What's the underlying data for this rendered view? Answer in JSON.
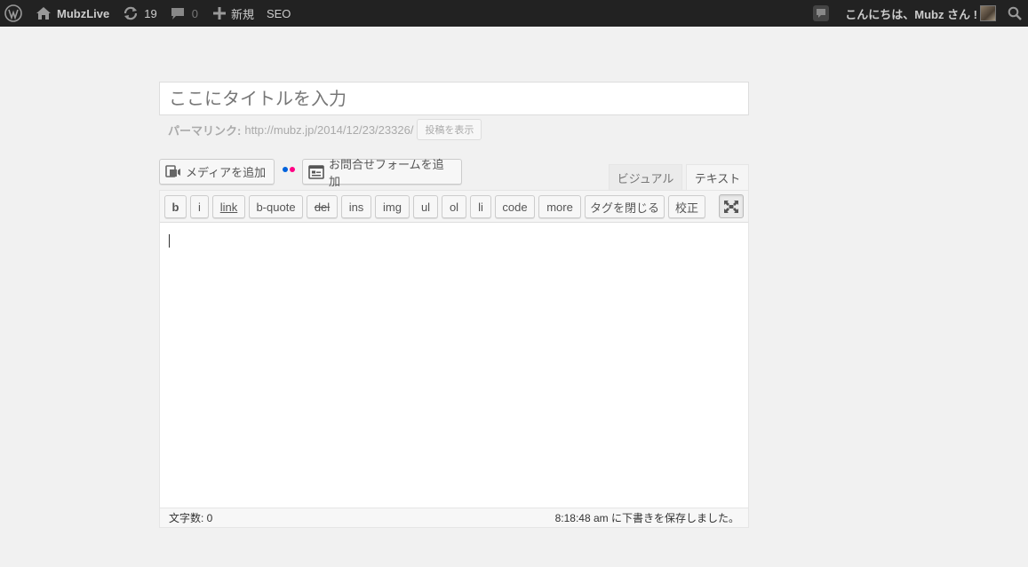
{
  "admin_bar": {
    "site_name": "MubzLive",
    "updates_count": "19",
    "comments_count": "0",
    "new_label": "新規",
    "seo_label": "SEO",
    "greeting": "こんにちは、Mubz さん !",
    "icons": [
      "wordpress-logo",
      "home-icon",
      "updates-icon",
      "comment-icon",
      "plus-icon",
      "notification-icon",
      "avatar",
      "search-icon"
    ]
  },
  "editor": {
    "title_placeholder": "ここにタイトルを入力",
    "permalink_label": "パーマリンク:",
    "permalink_url": "http://mubz.jp/2014/12/23/23326/",
    "view_post_label": "投稿を表示",
    "add_media_label": "メディアを追加",
    "contact_form_label": "お問合せフォームを追加",
    "tab_visual": "ビジュアル",
    "tab_text": "テキスト",
    "active_tab": "テキスト",
    "quicktags": {
      "b": "b",
      "i": "i",
      "link": "link",
      "bquote": "b-quote",
      "del": "del",
      "ins": "ins",
      "img": "img",
      "ul": "ul",
      "ol": "ol",
      "li": "li",
      "code": "code",
      "more": "more",
      "close_tags": "タグを閉じる",
      "proofread": "校正"
    },
    "content": "",
    "word_count": "文字数: 0",
    "autosave_status": "8:18:48 am に下書きを保存しました。"
  },
  "colors": {
    "admin_bar_bg": "#222222",
    "page_bg": "#f1f1f1",
    "flickr_blue": "#0063dc",
    "flickr_pink": "#ff0084"
  }
}
